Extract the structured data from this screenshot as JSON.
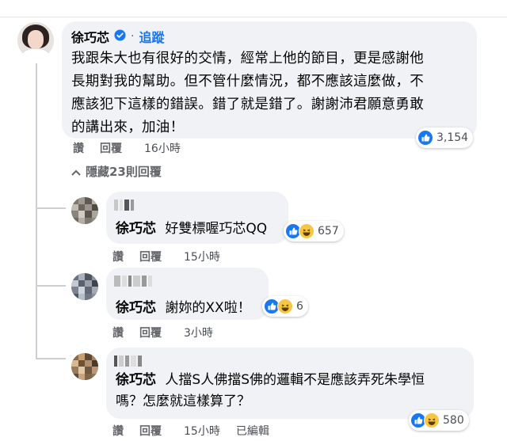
{
  "main_comment": {
    "author": "徐巧芯",
    "follow_label": "追蹤",
    "lines": [
      "我跟朱大也有很好的交情，經常上他的節目，更是感謝他",
      "長期對我的幫助。但不管什麼情況，都不應該這麼做，不",
      "應該犯下這樣的錯誤。錯了就是錯了。謝謝沛君願意勇敢",
      "的講出來，加油！"
    ],
    "actions": {
      "like": "讚",
      "reply": "回覆",
      "time": "16小時"
    },
    "reaction_count": "3,154"
  },
  "hide_replies_label": "隱藏23則回覆",
  "replies": [
    {
      "tag": "徐巧芯",
      "text": "好雙標喔巧芯QQ",
      "actions": {
        "like": "讚",
        "reply": "回覆",
        "time": "15小時"
      },
      "reaction_count": "657"
    },
    {
      "tag": "徐巧芯",
      "text": "謝妳的XX啦！",
      "actions": {
        "like": "讚",
        "reply": "回覆",
        "time": "3小時"
      },
      "reaction_count": "6"
    },
    {
      "tag": "徐巧芯",
      "text_line1": "人擋S人佛擋S佛的邏輯不是應該弄死朱學恒",
      "text_line2": "嗎？怎麼就這樣算了？",
      "actions": {
        "like": "讚",
        "reply": "回覆",
        "time": "15小時",
        "edited": "已編輯"
      },
      "reaction_count": "580"
    }
  ],
  "colors": {
    "link": "#1877f2",
    "bubble": "#f0f2f5",
    "muted": "#65676b"
  }
}
